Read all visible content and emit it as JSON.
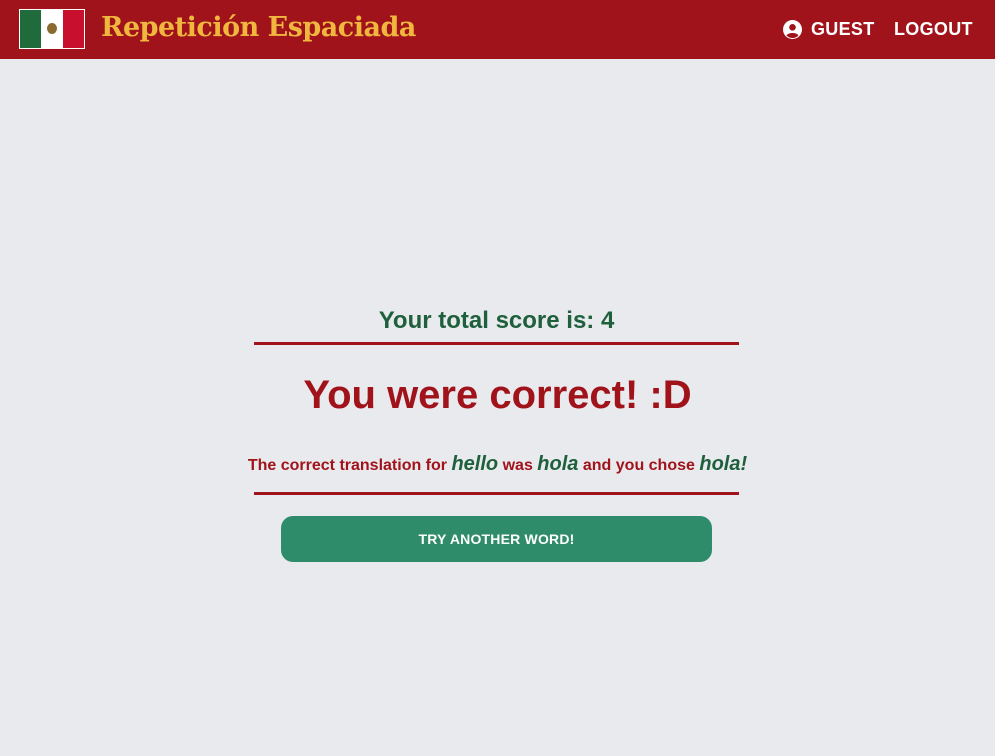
{
  "header": {
    "brand": "Repetición Espaciada",
    "user_label": "GUEST",
    "logout_label": "LOGOUT",
    "flag_icon": "mexico-flag-icon",
    "user_icon": "user-circle-icon"
  },
  "score": {
    "text": "Your total score is: 4"
  },
  "result": {
    "headline": "You were correct! :D",
    "prefix": "The correct translation for",
    "original_word": "hello",
    "was_label": "was",
    "translation_word": "hola",
    "chose_label": "and you chose",
    "chosen_word": "hola!"
  },
  "actions": {
    "try_again_label": "TRY ANOTHER WORD!"
  },
  "colors": {
    "header_bg": "#a1131b",
    "brand_text": "#f0b73f",
    "page_bg": "#e9eaed",
    "accent_green": "#1e5f3c",
    "button_green": "#2e8c6a",
    "accent_red": "#a1131b"
  }
}
